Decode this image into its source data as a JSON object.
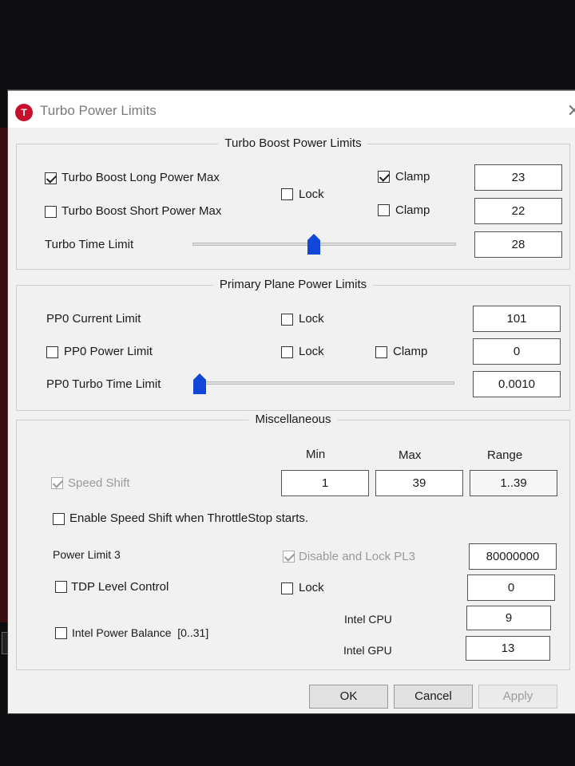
{
  "window": {
    "title": "Turbo Power Limits",
    "app_icon_letter": "T"
  },
  "turbo_boost": {
    "title": "Turbo Boost Power Limits",
    "long_power": {
      "label": "Turbo Boost Long Power Max",
      "checked": true,
      "clamp_label": "Clamp",
      "clamp_checked": true,
      "value": "23"
    },
    "short_power": {
      "label": "Turbo Boost Short Power Max",
      "checked": false,
      "clamp_label": "Clamp",
      "clamp_checked": false,
      "value": "22"
    },
    "lock_label": "Lock",
    "time_limit": {
      "label": "Turbo Time Limit",
      "value": "28",
      "slider_fraction": 0.46
    }
  },
  "primary_plane": {
    "title": "Primary Plane Power Limits",
    "current_limit": {
      "label": "PP0 Current Limit",
      "lock_label": "Lock",
      "value": "101"
    },
    "power_limit": {
      "label": "PP0 Power Limit",
      "lock_label": "Lock",
      "clamp_label": "Clamp",
      "value": "0"
    },
    "turbo_time": {
      "label": "PP0 Turbo Time Limit",
      "value": "0.0010",
      "slider_fraction": 0.02
    }
  },
  "misc": {
    "title": "Miscellaneous",
    "headers": {
      "min": "Min",
      "max": "Max",
      "range": "Range"
    },
    "speed_shift": {
      "label": "Speed Shift",
      "checked": true,
      "min": "1",
      "max": "39",
      "range": "1..39"
    },
    "enable_speed_shift": {
      "label": "Enable Speed Shift when ThrottleStop starts."
    },
    "power_limit3": {
      "label": "Power Limit 3",
      "disable_lock_label": "Disable and Lock PL3",
      "value": "80000000"
    },
    "tdp_level": {
      "label": "TDP Level Control",
      "lock_label": "Lock",
      "value": "0"
    },
    "power_balance": {
      "label": "Intel Power Balance  [0..31]",
      "cpu_label": "Intel CPU",
      "cpu_value": "9",
      "gpu_label": "Intel GPU",
      "gpu_value": "13"
    }
  },
  "buttons": {
    "ok": "OK",
    "cancel": "Cancel",
    "apply": "Apply"
  }
}
